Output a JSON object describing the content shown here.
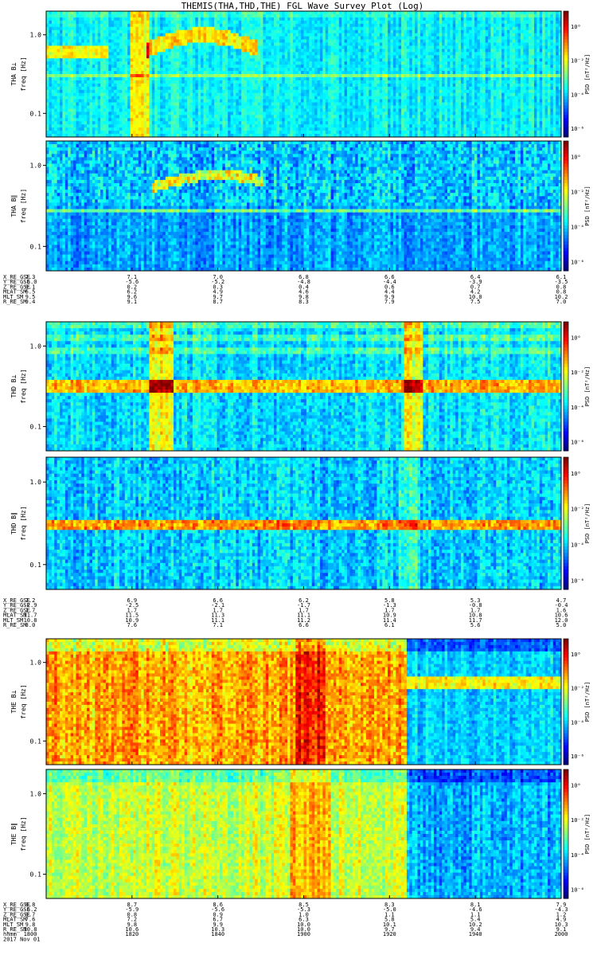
{
  "title": "THEMIS(THA,THD,THE) FGL Wave Survey Plot (Log)",
  "colorbar_label": "PSD [nT²/Hz]",
  "freq_label": "freq [Hz]",
  "freq_ticks": [
    "1.0",
    "0.1"
  ],
  "colorbar_ticks": [
    "10⁰",
    "10⁻²",
    "10⁻⁴",
    "10⁻⁶"
  ],
  "chart_data": [
    {
      "type": "heatmap",
      "probe": "THA",
      "panels": [
        {
          "ylabel": "THA B⊥",
          "component": "perp",
          "ylim_hz": [
            0.05,
            2.0
          ],
          "scale": "log"
        },
        {
          "ylabel": "THA B∥",
          "component": "par",
          "ylim_hz": [
            0.05,
            2.0
          ],
          "scale": "log"
        }
      ],
      "ephemeris": {
        "labels": [
          "X_RE_GSE",
          "Y_RE_GSE",
          "Z_RE_GSE",
          "MLAT_SM",
          "MLT_SM",
          "R_RE_SM"
        ],
        "rows": [
          [
            "7.3",
            "7.1",
            "7.0",
            "6.8",
            "6.6",
            "6.4",
            "6.1"
          ],
          [
            "-6.0",
            "-5.6",
            "-5.2",
            "-4.8",
            "-4.4",
            "-3.9",
            "-3.5"
          ],
          [
            "0.1",
            "0.2",
            "0.3",
            "0.4",
            "0.6",
            "0.7",
            "0.8"
          ],
          [
            "6.5",
            "6.2",
            "4.9",
            "4.6",
            "4.4",
            "4.2",
            "0.8"
          ],
          [
            "9.5",
            "9.6",
            "9.7",
            "9.8",
            "9.9",
            "10.0",
            "10.2"
          ],
          [
            "9.4",
            "9.1",
            "8.7",
            "8.3",
            "7.9",
            "7.5",
            "7.0"
          ]
        ]
      }
    },
    {
      "type": "heatmap",
      "probe": "THD",
      "panels": [
        {
          "ylabel": "THD B⊥",
          "component": "perp",
          "ylim_hz": [
            0.05,
            2.0
          ],
          "scale": "log"
        },
        {
          "ylabel": "THD B∥",
          "component": "par",
          "ylim_hz": [
            0.05,
            2.0
          ],
          "scale": "log"
        }
      ],
      "ephemeris": {
        "labels": [
          "X_RE_GSE",
          "Y_RE_GSE",
          "Z_RE_GSE",
          "MLAT_SM",
          "MLT_SM",
          "R_RE_SM"
        ],
        "rows": [
          [
            "7.2",
            "6.9",
            "6.6",
            "6.2",
            "5.8",
            "5.3",
            "4.7"
          ],
          [
            "-2.9",
            "-2.5",
            "-2.1",
            "-1.7",
            "-1.3",
            "-0.8",
            "-0.4"
          ],
          [
            "1.7",
            "1.7",
            "1.7",
            "1.7",
            "1.7",
            "1.7",
            "1.6"
          ],
          [
            "11.7",
            "11.5",
            "11.3",
            "11.1",
            "10.9",
            "10.8",
            "10.6"
          ],
          [
            "10.8",
            "10.9",
            "11.1",
            "11.2",
            "11.4",
            "11.7",
            "12.0"
          ],
          [
            "8.0",
            "7.6",
            "7.1",
            "6.6",
            "6.1",
            "5.6",
            "5.0"
          ]
        ]
      }
    },
    {
      "type": "heatmap",
      "probe": "THE",
      "panels": [
        {
          "ylabel": "THE B⊥",
          "component": "perp",
          "ylim_hz": [
            0.05,
            2.0
          ],
          "scale": "log"
        },
        {
          "ylabel": "THE B∥",
          "component": "par",
          "ylim_hz": [
            0.05,
            2.0
          ],
          "scale": "log"
        }
      ],
      "ephemeris": {
        "labels": [
          "X_RE_GSE",
          "Y_RE_GSE",
          "Z_RE_GSE",
          "MLAT_SM",
          "MLT_SM",
          "R_RE_SM",
          "hhmm",
          "2017 Nov 01"
        ],
        "rows": [
          [
            "8.8",
            "8.7",
            "8.6",
            "8.5",
            "8.3",
            "8.1",
            "7.9"
          ],
          [
            "-6.2",
            "-5.9",
            "-5.6",
            "-5.3",
            "-5.0",
            "-4.6",
            "-4.3"
          ],
          [
            "0.7",
            "0.8",
            "0.9",
            "1.0",
            "1.1",
            "1.1",
            "1.2"
          ],
          [
            "7.6",
            "7.2",
            "6.7",
            "6.3",
            "5.8",
            "5.4",
            "4.9"
          ],
          [
            "9.8",
            "9.8",
            "9.9",
            "10.0",
            "10.1",
            "10.2",
            "10.3"
          ],
          [
            "10.8",
            "10.6",
            "10.3",
            "10.0",
            "9.7",
            "9.4",
            "9.1"
          ],
          [
            "1800",
            "1820",
            "1840",
            "1900",
            "1920",
            "1940",
            "2000"
          ]
        ]
      }
    }
  ]
}
